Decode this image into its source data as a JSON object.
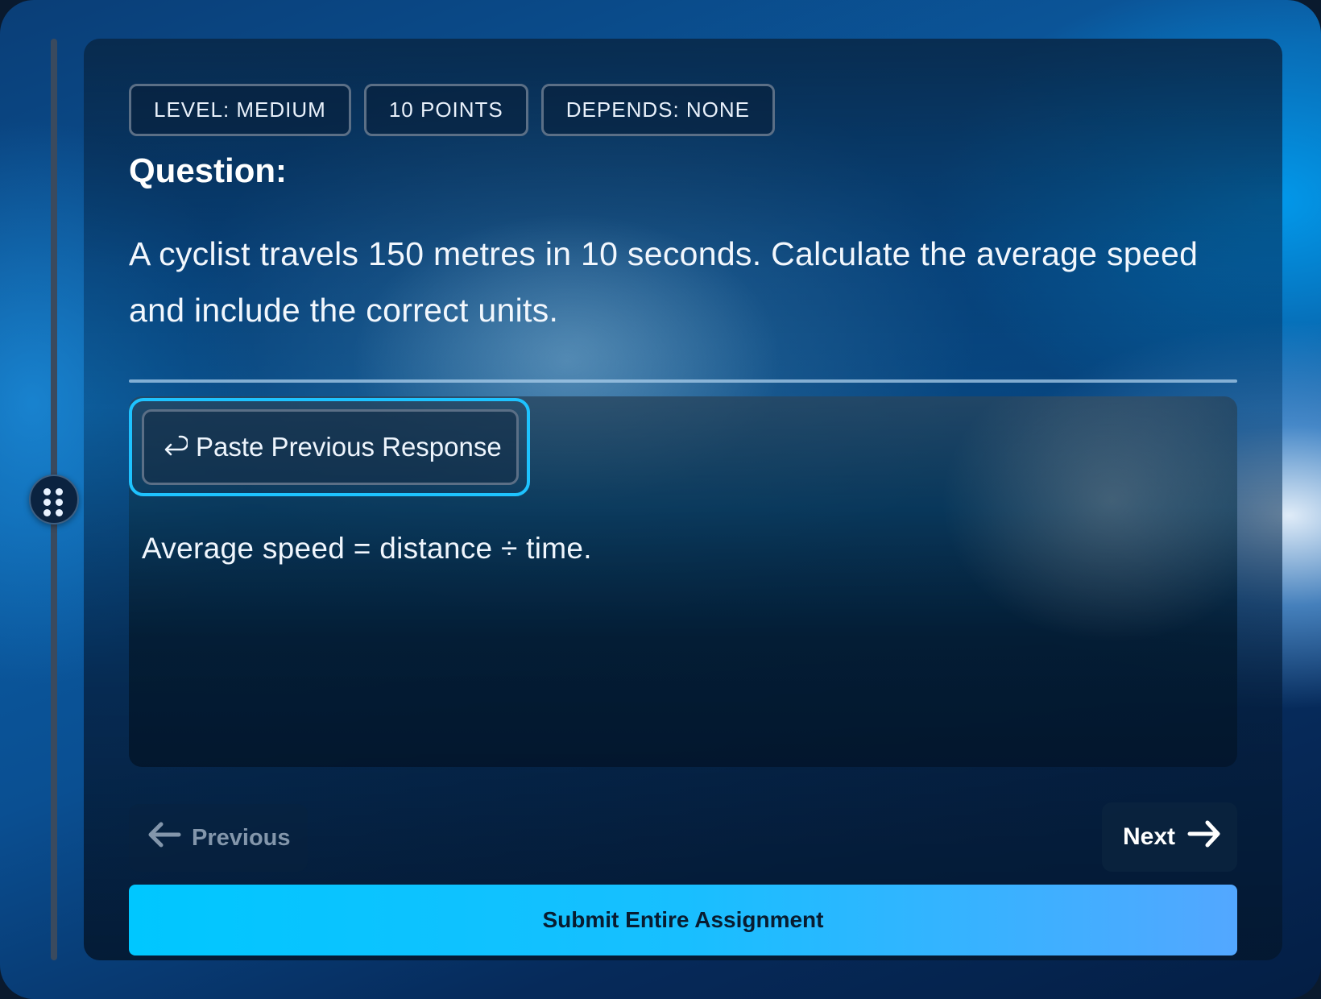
{
  "badges": {
    "level": "LEVEL:  MEDIUM",
    "points": "10  POINTS",
    "depends": "DEPENDS:  NONE"
  },
  "question": {
    "title": "Question:",
    "text": "A cyclist travels 150 metres in 10 seconds. Calculate the average speed and include the correct units."
  },
  "answer": {
    "paste_label": "Paste Previous Response",
    "text": "Average speed = distance ÷ time."
  },
  "nav": {
    "previous_label": "Previous",
    "next_label": "Next",
    "submit_label": "Submit Entire Assignment"
  },
  "colors": {
    "accent": "#1ec3ff",
    "submit_start": "#00c7ff",
    "submit_end": "#53a7ff"
  },
  "icons": {
    "handle": "drag-handle-icon",
    "paste": "return-arrow-icon",
    "previous": "arrow-left-icon",
    "next": "arrow-right-icon"
  }
}
